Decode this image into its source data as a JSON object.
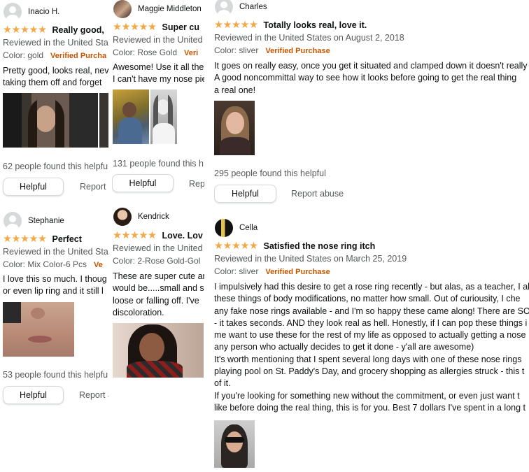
{
  "reviews": [
    {
      "reviewer": "Inacio H.",
      "stars": "★★★★★",
      "title": "Really good,",
      "meta": "Reviewed in the United Sta",
      "variant": "Color: gold",
      "verified": "Verified Purcha",
      "body": [
        "Pretty good, looks real, nev",
        "taking them off and forget"
      ],
      "helpful_count": "62 people found this helpfu",
      "helpful_label": "Helpful",
      "report_label": "Report"
    },
    {
      "reviewer": "Maggie Middleton",
      "stars": "★★★★★",
      "title": "Super cu",
      "meta": "Reviewed in the United",
      "variant": "Color: Rose Gold",
      "verified": "Veri",
      "body": [
        "Awesome! Use it all the",
        "I can't have my nose pie"
      ],
      "helpful_count": "131 people found this h",
      "helpful_label": "Helpful",
      "report_label": "Rep"
    },
    {
      "reviewer": "Charles",
      "stars": "★★★★★",
      "title": "Totally looks real, love it.",
      "meta": "Reviewed in the United States on August 2, 2018",
      "variant": "Color: sliver",
      "verified": "Verified Purchase",
      "body": [
        "It goes on really easy, once you get it situated and clamped down it doesn't really",
        "A good noncommittal way to see how it looks before going to get the real thing",
        "a real one!"
      ],
      "helpful_count": "295 people found this helpful",
      "helpful_label": "Helpful",
      "report_label": "Report abuse"
    },
    {
      "reviewer": "Stephanie",
      "stars": "★★★★★",
      "title": "Perfect",
      "meta": "Reviewed in the United Sta",
      "variant": "Color: Mix Color-6 Pcs",
      "verified": "Ve",
      "body": [
        "I love this so much. I thoug",
        "or even lip ring and it still l"
      ],
      "helpful_count": "53 people found this helpfu",
      "helpful_label": "Helpful",
      "report_label": "Report abuse"
    },
    {
      "reviewer": "Kendrick",
      "stars": "★★★★★",
      "title": "Love. Lov",
      "meta": "Reviewed in the United",
      "variant": "Color: 2-Rose Gold-Gol",
      "verified": "",
      "body": [
        "These are super cute an",
        "would be.....small and s",
        "loose or falling off. I've",
        "discoloration."
      ],
      "helpful_count": "",
      "helpful_label": "",
      "report_label": ""
    },
    {
      "reviewer": "Cella",
      "stars": "★★★★★",
      "title": "Satisfied the nose ring itch",
      "meta": "Reviewed in the United States on March 25, 2019",
      "variant": "Color: sliver",
      "verified": "Verified Purchase",
      "body": [
        "I impulsively had this desire to get a rose ring recently - but alas, as a teacher, I al",
        "these things of body modifications, no matter how small. Out of curiousity, I che",
        "any fake nose rings available - and I'm so happy these came along! There are SO",
        "- it takes seconds. AND they look real as hell. Honestly, if I can pop these things i",
        "me want to use these for the rest of my life as opposed to actually getting a nose",
        "any person who actually decides to get it done - y'all are awesome)",
        "It's worth mentioning that I spent several long days with one of these nose rings",
        "playing pool on St. Paddy's Day, and grocery shopping as allergies struck - this t",
        "of it.",
        "If you're looking for something new without the commitment, or even just want t",
        "like before doing the real thing, this is for you. Best 7 dollars I've spent in a long t"
      ],
      "helpful_count": "",
      "helpful_label": "",
      "report_label": ""
    }
  ]
}
